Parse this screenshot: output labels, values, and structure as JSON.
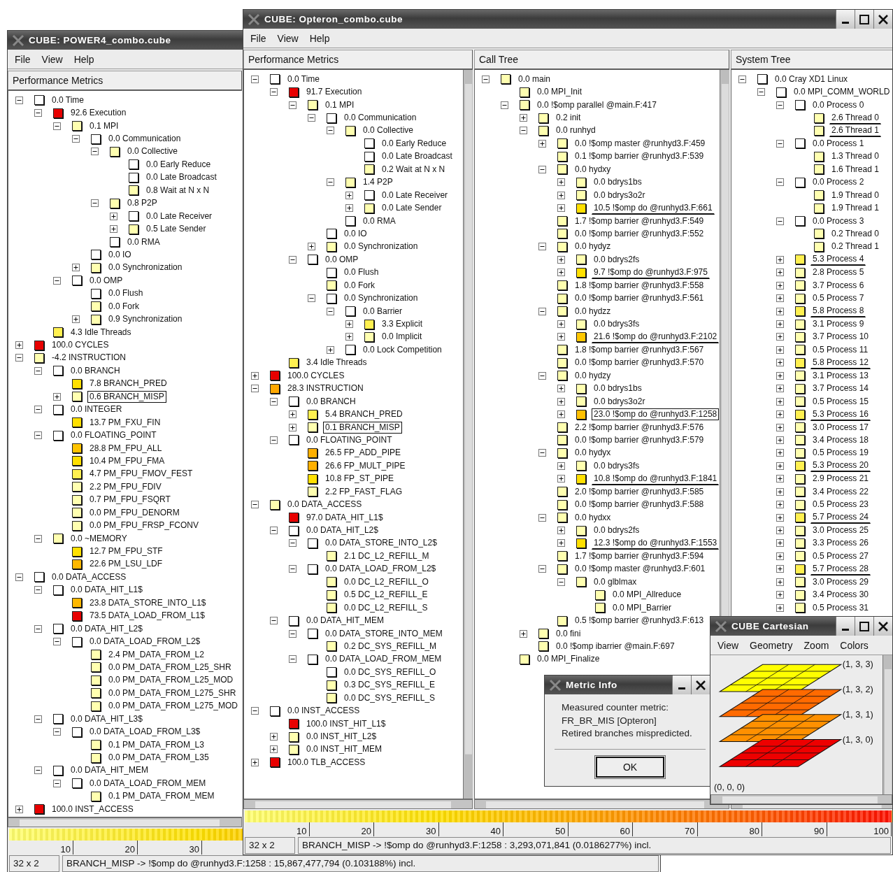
{
  "power4": {
    "title": "CUBE:  POWER4_combo.cube",
    "menu": [
      "File",
      "View",
      "Help"
    ],
    "pane_title": "Performance Metrics",
    "metrics": [
      {
        "text": "0.0 Time",
        "color": "#ffffff",
        "expanded": true,
        "children": [
          {
            "text": "92.6 Execution",
            "color": "#e80000",
            "expanded": true,
            "children": [
              {
                "text": "0.1 MPI",
                "color": "#ffffb0",
                "expanded": true,
                "children": [
                  {
                    "text": "0.0 Communication",
                    "color": "#ffffff",
                    "expanded": true,
                    "children": [
                      {
                        "text": "0.0 Collective",
                        "color": "#ffffb0",
                        "expanded": true,
                        "children": [
                          {
                            "text": "0.0 Early Reduce",
                            "color": "#ffffff"
                          },
                          {
                            "text": "0.0 Late Broadcast",
                            "color": "#ffffff"
                          },
                          {
                            "text": "0.8 Wait at N x N",
                            "color": "#ffffb0"
                          }
                        ]
                      },
                      {
                        "text": "0.8 P2P",
                        "color": "#ffffb0",
                        "expanded": true,
                        "children": [
                          {
                            "text": "0.0 Late Receiver",
                            "color": "#ffffff",
                            "expanded": false
                          },
                          {
                            "text": "0.5 Late Sender",
                            "color": "#ffffb0",
                            "expanded": false
                          }
                        ]
                      },
                      {
                        "text": "0.0 RMA",
                        "color": "#ffffff"
                      }
                    ]
                  },
                  {
                    "text": "0.0 IO",
                    "color": "#ffffff"
                  },
                  {
                    "text": "0.0 Synchronization",
                    "color": "#ffffb0",
                    "expanded": false
                  }
                ]
              },
              {
                "text": "0.0 OMP",
                "color": "#ffffff",
                "expanded": true,
                "children": [
                  {
                    "text": "0.0 Flush",
                    "color": "#ffffff"
                  },
                  {
                    "text": "0.0 Fork",
                    "color": "#ffffb0"
                  },
                  {
                    "text": "0.9 Synchronization",
                    "color": "#ffffb0",
                    "expanded": false
                  }
                ]
              }
            ]
          },
          {
            "text": "4.3 Idle Threads",
            "color": "#fff050"
          }
        ]
      },
      {
        "text": "100.0 CYCLES",
        "color": "#e80000",
        "expanded": false
      },
      {
        "text": "-4.2 INSTRUCTION",
        "color": "#ffffb0",
        "expanded": true,
        "children": [
          {
            "text": "0.0 BRANCH",
            "color": "#ffffff",
            "expanded": true,
            "children": [
              {
                "text": "7.8 BRANCH_PRED",
                "color": "#ffe000"
              },
              {
                "text": "0.6 BRANCH_MISP",
                "color": "#ffffb0",
                "expanded": false,
                "selected": true
              }
            ]
          },
          {
            "text": "0.0 INTEGER",
            "color": "#ffffff",
            "expanded": true,
            "children": [
              {
                "text": "13.7 PM_FXU_FIN",
                "color": "#ffe000"
              }
            ]
          },
          {
            "text": "0.0 FLOATING_POINT",
            "color": "#ffffff",
            "expanded": true,
            "children": [
              {
                "text": "28.8 PM_FPU_ALL",
                "color": "#ffc400"
              },
              {
                "text": "10.4 PM_FPU_FMA",
                "color": "#ffe000"
              },
              {
                "text": "4.7 PM_FPU_FMOV_FEST",
                "color": "#fff050"
              },
              {
                "text": "2.2 PM_FPU_FDIV",
                "color": "#ffffb0"
              },
              {
                "text": "0.7 PM_FPU_FSQRT",
                "color": "#ffffb0"
              },
              {
                "text": "0.0 PM_FPU_DENORM",
                "color": "#ffffb0"
              },
              {
                "text": "0.0 PM_FPU_FRSP_FCONV",
                "color": "#ffffb0"
              }
            ]
          },
          {
            "text": "0.0 ~MEMORY",
            "color": "#ffffb0",
            "expanded": true,
            "children": [
              {
                "text": "12.7 PM_FPU_STF",
                "color": "#ffe000"
              },
              {
                "text": "22.6 PM_LSU_LDF",
                "color": "#ffb800"
              }
            ]
          }
        ]
      },
      {
        "text": "0.0 DATA_ACCESS",
        "color": "#ffffff",
        "expanded": true,
        "children": [
          {
            "text": "0.0 DATA_HIT_L1$",
            "color": "#ffffff",
            "expanded": true,
            "children": [
              {
                "text": "23.8 DATA_STORE_INTO_L1$",
                "color": "#ffb800"
              },
              {
                "text": "73.5 DATA_LOAD_FROM_L1$",
                "color": "#e80000"
              }
            ]
          },
          {
            "text": "0.0 DATA_HIT_L2$",
            "color": "#ffffff",
            "expanded": true,
            "children": [
              {
                "text": "0.0 DATA_LOAD_FROM_L2$",
                "color": "#ffffff",
                "expanded": true,
                "children": [
                  {
                    "text": "2.4 PM_DATA_FROM_L2",
                    "color": "#ffffb0"
                  },
                  {
                    "text": "0.0 PM_DATA_FROM_L25_SHR",
                    "color": "#ffffb0"
                  },
                  {
                    "text": "0.0 PM_DATA_FROM_L25_MOD",
                    "color": "#ffffb0"
                  },
                  {
                    "text": "0.0 PM_DATA_FROM_L275_SHR",
                    "color": "#ffffb0"
                  },
                  {
                    "text": "0.0 PM_DATA_FROM_L275_MOD",
                    "color": "#ffffb0"
                  }
                ]
              }
            ]
          },
          {
            "text": "0.0 DATA_HIT_L3$",
            "color": "#ffffff",
            "expanded": true,
            "children": [
              {
                "text": "0.0 DATA_LOAD_FROM_L3$",
                "color": "#ffffff",
                "expanded": true,
                "children": [
                  {
                    "text": "0.1 PM_DATA_FROM_L3",
                    "color": "#ffffb0"
                  },
                  {
                    "text": "0.0 PM_DATA_FROM_L35",
                    "color": "#ffffb0"
                  }
                ]
              }
            ]
          },
          {
            "text": "0.0 DATA_HIT_MEM",
            "color": "#ffffff",
            "expanded": true,
            "children": [
              {
                "text": "0.0 DATA_LOAD_FROM_MEM",
                "color": "#ffffff",
                "expanded": true,
                "children": [
                  {
                    "text": "0.1 PM_DATA_FROM_MEM",
                    "color": "#ffffb0"
                  }
                ]
              }
            ]
          }
        ]
      },
      {
        "text": "100.0 INST_ACCESS",
        "color": "#e80000",
        "expanded": false
      }
    ],
    "scale_ticks": [
      "10",
      "20",
      "30"
    ],
    "status": {
      "dims": "32 x 2",
      "message": "BRANCH_MISP -> !$omp do @runhyd3.F:1258 : 15,867,477,794 (0.103188%)  incl."
    }
  },
  "opteron": {
    "title": "CUBE:  Opteron_combo.cube",
    "menu": [
      "File",
      "View",
      "Help"
    ],
    "pane_titles": [
      "Performance Metrics",
      "Call Tree",
      "System Tree"
    ],
    "metrics": [
      {
        "text": "0.0 Time",
        "color": "#ffffff",
        "expanded": true,
        "children": [
          {
            "text": "91.7 Execution",
            "color": "#e80000",
            "expanded": true,
            "children": [
              {
                "text": "0.1 MPI",
                "color": "#ffffb0",
                "expanded": true,
                "children": [
                  {
                    "text": "0.0 Communication",
                    "color": "#ffffff",
                    "expanded": true,
                    "children": [
                      {
                        "text": "0.0 Collective",
                        "color": "#ffffb0",
                        "expanded": true,
                        "children": [
                          {
                            "text": "0.0 Early Reduce",
                            "color": "#ffffff"
                          },
                          {
                            "text": "0.0 Late Broadcast",
                            "color": "#ffffff"
                          },
                          {
                            "text": "0.2 Wait at N x N",
                            "color": "#ffffb0"
                          }
                        ]
                      },
                      {
                        "text": "1.4 P2P",
                        "color": "#ffffb0",
                        "expanded": true,
                        "children": [
                          {
                            "text": "0.0 Late Receiver",
                            "color": "#ffffff",
                            "expanded": false
                          },
                          {
                            "text": "0.0 Late Sender",
                            "color": "#ffffb0",
                            "expanded": false
                          }
                        ]
                      },
                      {
                        "text": "0.0 RMA",
                        "color": "#ffffff"
                      }
                    ]
                  },
                  {
                    "text": "0.0 IO",
                    "color": "#ffffff"
                  },
                  {
                    "text": "0.0 Synchronization",
                    "color": "#ffffb0",
                    "expanded": false
                  }
                ]
              },
              {
                "text": "0.0 OMP",
                "color": "#ffffff",
                "expanded": true,
                "children": [
                  {
                    "text": "0.0 Flush",
                    "color": "#ffffff"
                  },
                  {
                    "text": "0.0 Fork",
                    "color": "#ffffb0"
                  },
                  {
                    "text": "0.0 Synchronization",
                    "color": "#ffffff",
                    "expanded": true,
                    "children": [
                      {
                        "text": "0.0 Barrier",
                        "color": "#ffffff",
                        "expanded": true,
                        "children": [
                          {
                            "text": "3.3 Explicit",
                            "color": "#fff050",
                            "expanded": false
                          },
                          {
                            "text": "0.0 Implicit",
                            "color": "#ffffb0",
                            "expanded": false
                          }
                        ]
                      },
                      {
                        "text": "0.0 Lock Competition",
                        "color": "#ffffff",
                        "expanded": false
                      }
                    ]
                  }
                ]
              }
            ]
          },
          {
            "text": "3.4 Idle Threads",
            "color": "#fff050"
          }
        ]
      },
      {
        "text": "100.0 CYCLES",
        "color": "#e80000",
        "expanded": false
      },
      {
        "text": "28.3 INSTRUCTION",
        "color": "#ffa800",
        "expanded": true,
        "children": [
          {
            "text": "0.0 BRANCH",
            "color": "#ffffff",
            "expanded": true,
            "children": [
              {
                "text": "5.4 BRANCH_PRED",
                "color": "#fff050",
                "expanded": false
              },
              {
                "text": "0.1 BRANCH_MISP",
                "color": "#ffffb0",
                "expanded": false,
                "selected": true
              }
            ]
          },
          {
            "text": "0.0 FLOATING_POINT",
            "color": "#ffffff",
            "expanded": true,
            "children": [
              {
                "text": "26.5 FP_ADD_PIPE",
                "color": "#ffb000"
              },
              {
                "text": "26.6 FP_MULT_PIPE",
                "color": "#ffb000"
              },
              {
                "text": "10.8 FP_ST_PIPE",
                "color": "#ffe000"
              },
              {
                "text": "2.2 FP_FAST_FLAG",
                "color": "#ffffb0"
              }
            ]
          }
        ]
      },
      {
        "text": "0.0 DATA_ACCESS",
        "color": "#ffffb0",
        "expanded": true,
        "children": [
          {
            "text": "97.0 DATA_HIT_L1$",
            "color": "#e80000"
          },
          {
            "text": "0.0 DATA_HIT_L2$",
            "color": "#ffffff",
            "expanded": true,
            "children": [
              {
                "text": "0.0 DATA_STORE_INTO_L2$",
                "color": "#ffffff",
                "expanded": true,
                "children": [
                  {
                    "text": "2.1 DC_L2_REFILL_M",
                    "color": "#ffffb0"
                  }
                ]
              },
              {
                "text": "0.0 DATA_LOAD_FROM_L2$",
                "color": "#ffffff",
                "expanded": true,
                "children": [
                  {
                    "text": "0.0 DC_L2_REFILL_O",
                    "color": "#ffffb0"
                  },
                  {
                    "text": "0.5 DC_L2_REFILL_E",
                    "color": "#ffffb0"
                  },
                  {
                    "text": "0.0 DC_L2_REFILL_S",
                    "color": "#ffffb0"
                  }
                ]
              }
            ]
          },
          {
            "text": "0.0 DATA_HIT_MEM",
            "color": "#ffffff",
            "expanded": true,
            "children": [
              {
                "text": "0.0 DATA_STORE_INTO_MEM",
                "color": "#ffffff",
                "expanded": true,
                "children": [
                  {
                    "text": "0.2 DC_SYS_REFILL_M",
                    "color": "#ffffb0"
                  }
                ]
              },
              {
                "text": "0.0 DATA_LOAD_FROM_MEM",
                "color": "#ffffff",
                "expanded": true,
                "children": [
                  {
                    "text": "0.0 DC_SYS_REFILL_O",
                    "color": "#ffffff"
                  },
                  {
                    "text": "0.3 DC_SYS_REFILL_E",
                    "color": "#ffffb0"
                  },
                  {
                    "text": "0.0 DC_SYS_REFILL_S",
                    "color": "#ffffb0"
                  }
                ]
              }
            ]
          }
        ]
      },
      {
        "text": "0.0 INST_ACCESS",
        "color": "#ffffff",
        "expanded": true,
        "children": [
          {
            "text": "100.0 INST_HIT_L1$",
            "color": "#e80000"
          },
          {
            "text": "0.0 INST_HIT_L2$",
            "color": "#ffffb0",
            "expanded": false
          },
          {
            "text": "0.0 INST_HIT_MEM",
            "color": "#ffffb0",
            "expanded": false
          }
        ]
      },
      {
        "text": "100.0 TLB_ACCESS",
        "color": "#e80000",
        "expanded": false
      }
    ],
    "call_tree": [
      {
        "text": "0.0 main",
        "color": "#ffffb0",
        "expanded": true,
        "children": [
          {
            "text": "0.0 MPI_Init",
            "color": "#ffffb0"
          },
          {
            "text": "0.0 !$omp parallel @main.F:417",
            "color": "#ffffb0",
            "expanded": true,
            "children": [
              {
                "text": "0.2 init",
                "color": "#ffffb0",
                "expanded": false
              },
              {
                "text": "0.0 runhyd",
                "color": "#ffffb0",
                "expanded": true,
                "children": [
                  {
                    "text": "0.0 !$omp master @runhyd3.F:459",
                    "color": "#ffffb0",
                    "expanded": false
                  },
                  {
                    "text": "0.1 !$omp barrier @runhyd3.F:539",
                    "color": "#ffffb0"
                  },
                  {
                    "text": "0.0 hydxy",
                    "color": "#ffffb0",
                    "expanded": true,
                    "children": [
                      {
                        "text": "0.0 bdrys1bs",
                        "color": "#ffffb0",
                        "expanded": false
                      },
                      {
                        "text": "0.0 bdrys3o2r",
                        "color": "#ffffb0",
                        "expanded": false
                      },
                      {
                        "text": "10.5 !$omp do @runhyd3.F:661",
                        "color": "#ffe000",
                        "expanded": false,
                        "underlined": true
                      }
                    ]
                  },
                  {
                    "text": "1.7 !$omp barrier @runhyd3.F:549",
                    "color": "#ffffb0"
                  },
                  {
                    "text": "0.0 !$omp barrier @runhyd3.F:552",
                    "color": "#ffffb0"
                  },
                  {
                    "text": "0.0 hydyz",
                    "color": "#ffffb0",
                    "expanded": true,
                    "children": [
                      {
                        "text": "0.0 bdrys2fs",
                        "color": "#ffffb0",
                        "expanded": false
                      },
                      {
                        "text": "9.7 !$omp do @runhyd3.F:975",
                        "color": "#ffe000",
                        "expanded": false,
                        "underlined": true
                      }
                    ]
                  },
                  {
                    "text": "1.8 !$omp barrier @runhyd3.F:558",
                    "color": "#ffffb0"
                  },
                  {
                    "text": "0.0 !$omp barrier @runhyd3.F:561",
                    "color": "#ffffb0"
                  },
                  {
                    "text": "0.0 hydzz",
                    "color": "#ffffb0",
                    "expanded": true,
                    "children": [
                      {
                        "text": "0.0 bdrys3fs",
                        "color": "#ffffb0",
                        "expanded": false
                      },
                      {
                        "text": "21.6 !$omp do @runhyd3.F:2102",
                        "color": "#ffc800",
                        "expanded": false,
                        "underlined": true
                      }
                    ]
                  },
                  {
                    "text": "1.8 !$omp barrier @runhyd3.F:567",
                    "color": "#ffffb0"
                  },
                  {
                    "text": "0.0 !$omp barrier @runhyd3.F:570",
                    "color": "#ffffb0"
                  },
                  {
                    "text": "0.0 hydzy",
                    "color": "#ffffb0",
                    "expanded": true,
                    "children": [
                      {
                        "text": "0.0 bdrys1bs",
                        "color": "#ffffb0",
                        "expanded": false
                      },
                      {
                        "text": "0.0 bdrys3o2r",
                        "color": "#ffffb0",
                        "expanded": false
                      },
                      {
                        "text": "23.0 !$omp do @runhyd3.F:1258",
                        "color": "#ffc000",
                        "expanded": false,
                        "selected": true
                      }
                    ]
                  },
                  {
                    "text": "2.2 !$omp barrier @runhyd3.F:576",
                    "color": "#ffffb0"
                  },
                  {
                    "text": "0.0 !$omp barrier @runhyd3.F:579",
                    "color": "#ffffb0"
                  },
                  {
                    "text": "0.0 hydyx",
                    "color": "#ffffb0",
                    "expanded": true,
                    "children": [
                      {
                        "text": "0.0 bdrys3fs",
                        "color": "#ffffb0",
                        "expanded": false
                      },
                      {
                        "text": "10.8 !$omp do @runhyd3.F:1841",
                        "color": "#ffe000",
                        "expanded": false,
                        "underlined": true
                      }
                    ]
                  },
                  {
                    "text": "2.0 !$omp barrier @runhyd3.F:585",
                    "color": "#ffffb0"
                  },
                  {
                    "text": "0.0 !$omp barrier @runhyd3.F:588",
                    "color": "#ffffb0"
                  },
                  {
                    "text": "0.0 hydxx",
                    "color": "#ffffb0",
                    "expanded": true,
                    "children": [
                      {
                        "text": "0.0 bdrys2fs",
                        "color": "#ffffb0",
                        "expanded": false
                      },
                      {
                        "text": "12.3 !$omp do @runhyd3.F:1553",
                        "color": "#ffe000",
                        "expanded": false,
                        "underlined": true
                      }
                    ]
                  },
                  {
                    "text": "1.7 !$omp barrier @runhyd3.F:594",
                    "color": "#ffffb0"
                  },
                  {
                    "text": "0.0 !$omp master @runhyd3.F:601",
                    "color": "#ffffb0",
                    "expanded": true,
                    "children": [
                      {
                        "text": "0.0 glblmax",
                        "color": "#ffffb0",
                        "expanded": true,
                        "children": [
                          {
                            "text": "0.0 MPI_Allreduce",
                            "color": "#ffffb0"
                          },
                          {
                            "text": "0.0 MPI_Barrier",
                            "color": "#ffffb0"
                          }
                        ]
                      }
                    ]
                  },
                  {
                    "text": "0.5 !$omp barrier @runhyd3.F:613",
                    "color": "#ffffb0"
                  }
                ]
              },
              {
                "text": "0.0 fini",
                "color": "#ffffb0",
                "expanded": false
              },
              {
                "text": "0.0 !$omp ibarrier @main.F:697",
                "color": "#ffffb0"
              }
            ]
          },
          {
            "text": "0.0 MPI_Finalize",
            "color": "#ffffb0"
          }
        ]
      }
    ],
    "system_tree": [
      {
        "text": "0.0 Cray XD1 Linux",
        "color": "#ffffff",
        "expanded": true,
        "children": [
          {
            "text": "0.0 MPI_COMM_WORLD",
            "color": "#ffffff",
            "expanded": true,
            "children": [
              {
                "text": "0.0 Process 0",
                "color": "#ffffff",
                "expanded": true,
                "children": [
                  {
                    "text": "2.6 Thread 0",
                    "color": "#ffffb0",
                    "underlined": true
                  },
                  {
                    "text": "2.6 Thread 1",
                    "color": "#ffffb0",
                    "underlined": true
                  }
                ]
              },
              {
                "text": "0.0 Process 1",
                "color": "#ffffff",
                "expanded": true,
                "children": [
                  {
                    "text": "1.3 Thread 0",
                    "color": "#ffffb0"
                  },
                  {
                    "text": "1.6 Thread 1",
                    "color": "#ffffb0"
                  }
                ]
              },
              {
                "text": "0.0 Process 2",
                "color": "#ffffff",
                "expanded": true,
                "children": [
                  {
                    "text": "1.9 Thread 0",
                    "color": "#ffffb0"
                  },
                  {
                    "text": "1.9 Thread 1",
                    "color": "#ffffb0"
                  }
                ]
              },
              {
                "text": "0.0 Process 3",
                "color": "#ffffff",
                "expanded": true,
                "children": [
                  {
                    "text": "0.2 Thread 0",
                    "color": "#ffffb0"
                  },
                  {
                    "text": "0.2 Thread 1",
                    "color": "#ffffb0"
                  }
                ]
              },
              {
                "text": "5.3 Process 4",
                "color": "#fff050",
                "expanded": false,
                "underlined": true
              },
              {
                "text": "2.8 Process 5",
                "color": "#ffffb0",
                "expanded": false
              },
              {
                "text": "3.7 Process 6",
                "color": "#ffffb0",
                "expanded": false
              },
              {
                "text": "0.5 Process 7",
                "color": "#ffffb0",
                "expanded": false
              },
              {
                "text": "5.8 Process 8",
                "color": "#fff050",
                "expanded": false,
                "underlined": true
              },
              {
                "text": "3.1 Process 9",
                "color": "#ffffb0",
                "expanded": false
              },
              {
                "text": "3.7 Process 10",
                "color": "#ffffb0",
                "expanded": false
              },
              {
                "text": "0.5 Process 11",
                "color": "#ffffb0",
                "expanded": false
              },
              {
                "text": "5.8 Process 12",
                "color": "#fff050",
                "expanded": false,
                "underlined": true
              },
              {
                "text": "3.1 Process 13",
                "color": "#ffffb0",
                "expanded": false
              },
              {
                "text": "3.7 Process 14",
                "color": "#ffffb0",
                "expanded": false
              },
              {
                "text": "0.5 Process 15",
                "color": "#ffffb0",
                "expanded": false
              },
              {
                "text": "5.3 Process 16",
                "color": "#fff050",
                "expanded": false,
                "underlined": true
              },
              {
                "text": "3.0 Process 17",
                "color": "#ffffb0",
                "expanded": false
              },
              {
                "text": "3.4 Process 18",
                "color": "#ffffb0",
                "expanded": false
              },
              {
                "text": "0.5 Process 19",
                "color": "#ffffb0",
                "expanded": false
              },
              {
                "text": "5.3 Process 20",
                "color": "#fff050",
                "expanded": false,
                "underlined": true
              },
              {
                "text": "2.9 Process 21",
                "color": "#ffffb0",
                "expanded": false
              },
              {
                "text": "3.4 Process 22",
                "color": "#ffffb0",
                "expanded": false
              },
              {
                "text": "0.5 Process 23",
                "color": "#ffffb0",
                "expanded": false
              },
              {
                "text": "5.7 Process 24",
                "color": "#fff050",
                "expanded": false,
                "underlined": true
              },
              {
                "text": "3.0 Process 25",
                "color": "#ffffb0",
                "expanded": false
              },
              {
                "text": "3.3 Process 26",
                "color": "#ffffb0",
                "expanded": false
              },
              {
                "text": "0.5 Process 27",
                "color": "#ffffb0",
                "expanded": false
              },
              {
                "text": "5.7 Process 28",
                "color": "#fff050",
                "expanded": false,
                "underlined": true
              },
              {
                "text": "3.0 Process 29",
                "color": "#ffffb0",
                "expanded": false
              },
              {
                "text": "3.4 Process 30",
                "color": "#ffffb0",
                "expanded": false
              },
              {
                "text": "0.5 Process 31",
                "color": "#ffffb0",
                "expanded": false
              }
            ]
          }
        ]
      }
    ],
    "scale_ticks": [
      "10",
      "20",
      "30",
      "40",
      "50",
      "60",
      "70",
      "80",
      "90",
      "100"
    ],
    "status": {
      "dims": "32 x 2",
      "message": "BRANCH_MISP -> !$omp do @runhyd3.F:1258 : 3,293,071,841 (0.0186277%)  incl."
    }
  },
  "metric_info": {
    "title": "Metric Info",
    "lines": [
      "Measured counter metric:",
      "FR_BR_MIS  [Opteron]",
      "Retired branches mispredicted."
    ],
    "button": "OK"
  },
  "cartesian": {
    "title": "CUBE Cartesian",
    "menu": [
      "View",
      "Geometry",
      "Zoom",
      "Colors"
    ],
    "layers": [
      {
        "label": "(1, 3, 3)",
        "color": "#ffff00"
      },
      {
        "label": "(1, 3, 2)",
        "color": "#ff6a00"
      },
      {
        "label": "(1, 3, 1)",
        "color": "#ff9000"
      },
      {
        "label": "(1, 3, 0)",
        "color": "#ee0000"
      }
    ],
    "origin_label": "(0, 0, 0)"
  }
}
